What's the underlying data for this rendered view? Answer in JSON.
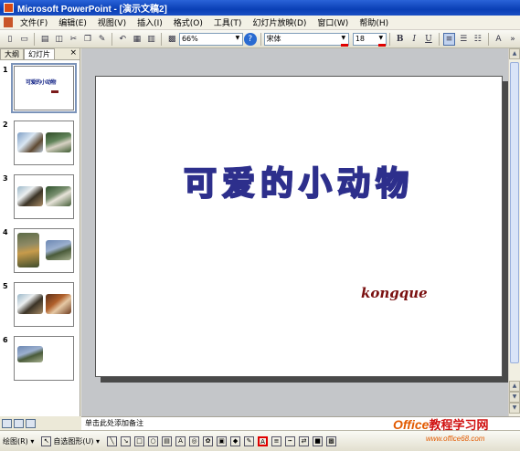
{
  "window": {
    "title": "Microsoft PowerPoint - [演示文稿2]"
  },
  "menu": [
    "文件(F)",
    "编辑(E)",
    "视图(V)",
    "插入(I)",
    "格式(O)",
    "工具(T)",
    "幻灯片放映(D)",
    "窗口(W)",
    "帮助(H)"
  ],
  "toolbar": {
    "zoom": "66%",
    "font": "宋体",
    "size": "18",
    "bold": "B",
    "italic": "I",
    "underline": "U"
  },
  "pane": {
    "tab_outline": "大纲",
    "tab_slides": "幻灯片",
    "close": "×"
  },
  "thumbs": [
    "1",
    "2",
    "3",
    "4",
    "5",
    "6"
  ],
  "thumb1_title": "可爱的小动物",
  "slide": {
    "title": "可爱的小动物",
    "subtitle": "kongque"
  },
  "notes": {
    "placeholder": "单击此处添加备注"
  },
  "drawbar": {
    "draw": "绘图(R) ▾",
    "autoshapes": "自选图形(U) ▾"
  },
  "watermark": {
    "brand": "Office",
    "cn": "教程学习网",
    "url": "www.office68.com"
  }
}
